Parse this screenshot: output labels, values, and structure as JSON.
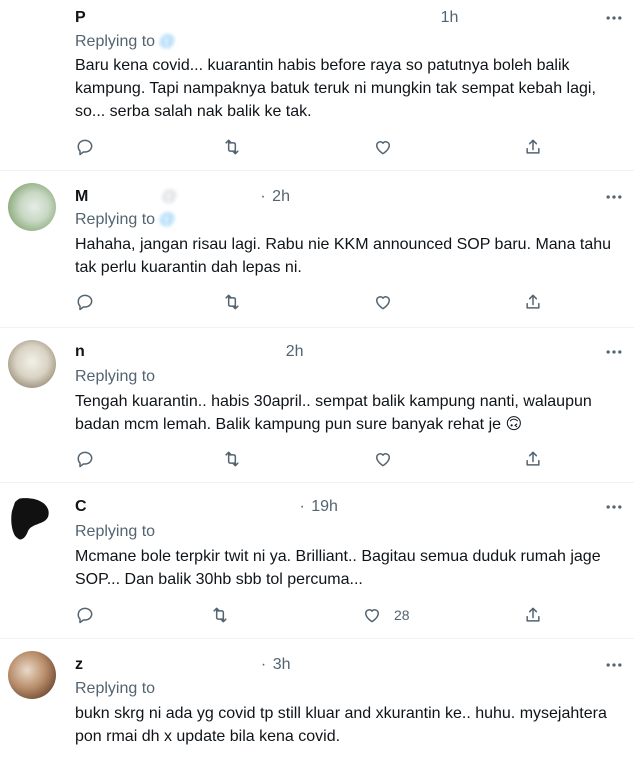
{
  "tweets": [
    {
      "name": "P",
      "handle": "",
      "dot": "·",
      "time": "1h",
      "replying_label": "Replying to",
      "mention": "@",
      "text": "Baru kena covid... kuarantin habis before raya so patutnya boleh balik kampung. Tapi nampaknya batuk teruk ni mungkin tak sempat kebah lagi, so... serba salah nak balik ke tak.",
      "likes": ""
    },
    {
      "name": "M",
      "handle": "@",
      "dot": "·",
      "time": "2h",
      "replying_label": "Replying to",
      "mention": "@",
      "text": "Hahaha, jangan risau lagi. Rabu nie KKM announced SOP baru. Mana tahu tak perlu kuarantin dah lepas ni.",
      "likes": ""
    },
    {
      "name": "n",
      "handle": "",
      "dot": "",
      "time": "2h",
      "replying_label": "Replying to",
      "mention": "",
      "text": "Tengah kuarantin.. habis 30april.. sempat balik kampung nanti, walaupun badan mcm lemah. Balik kampung pun sure banyak rehat je 🙃",
      "likes": ""
    },
    {
      "name": "C",
      "handle": "",
      "dot": "·",
      "time": "19h",
      "replying_label": "Replying to",
      "mention": "",
      "text": "Mcmane bole terpkir twit ni ya. Brilliant.. Bagitau semua duduk rumah jage SOP... Dan balik 30hb sbb tol percuma...",
      "likes": "28"
    },
    {
      "name": "z",
      "handle": "",
      "dot": "·",
      "time": "3h",
      "replying_label": "Replying to",
      "mention": "",
      "text": "bukn skrg ni ada yg covid tp still kluar and xkurantin ke.. huhu. mysejahtera pon rmai dh x update bila kena covid.",
      "likes": ""
    }
  ],
  "icons": {
    "reply": "reply-icon",
    "retweet": "retweet-icon",
    "like": "like-icon",
    "share": "share-icon",
    "more": "more-icon"
  },
  "colors": {
    "text": "#0f1419",
    "secondary": "#536471",
    "link": "#1d9bf0",
    "divider": "#eff3f4"
  }
}
